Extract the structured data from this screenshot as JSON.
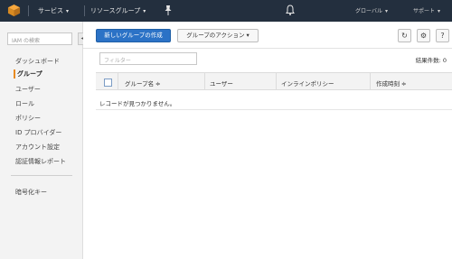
{
  "topbar": {
    "services_label": "サービス",
    "resource_groups_label": "リソースグループ",
    "account_label": "グローバル",
    "support_label": "サポート"
  },
  "sidebar": {
    "search_placeholder": "IAM の検索",
    "collapse_glyph": "◂",
    "items": [
      {
        "label": "ダッシュボード"
      },
      {
        "label": "グループ",
        "active": true
      },
      {
        "label": "ユーザー"
      },
      {
        "label": "ロール"
      },
      {
        "label": "ポリシー"
      },
      {
        "label": "ID プロバイダー"
      },
      {
        "label": "アカウント設定"
      },
      {
        "label": "認証情報レポート"
      }
    ],
    "encryption_keys_label": "暗号化キー"
  },
  "toolbar": {
    "create_group_label": "新しいグループの作成",
    "group_actions_label": "グループのアクション ▾"
  },
  "icons": {
    "refresh": "↻",
    "settings": "⚙",
    "help": "?"
  },
  "filter": {
    "placeholder": "フィルター"
  },
  "results": {
    "count_label": "結果件数: 0"
  },
  "table": {
    "columns": [
      {
        "label": "グループ名 ≑"
      },
      {
        "label": "ユーザー"
      },
      {
        "label": "インラインポリシー"
      },
      {
        "label": "作成時刻 ≑"
      }
    ],
    "empty_message": "レコードが見つかりません。"
  },
  "colors": {
    "topbar_bg": "#232f3e",
    "primary_button": "#2b72c6",
    "active_accent": "#e88b22"
  }
}
